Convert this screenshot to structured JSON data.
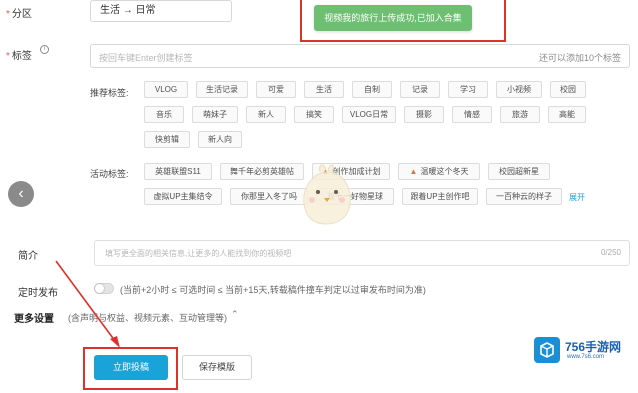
{
  "category": {
    "label": "分区",
    "value": "生活 → 日常"
  },
  "toast": {
    "text": "视频我的旅行上传成功,已加入合集"
  },
  "tags": {
    "label": "标签",
    "placeholder": "按回车键Enter创建标签",
    "hint": "还可以添加10个标签",
    "recommended_label": "推荐标签:",
    "recommended": [
      "VLOG",
      "生活记录",
      "可爱",
      "生活",
      "自制",
      "记录",
      "学习",
      "小视频",
      "校园",
      "音乐",
      "萌妹子",
      "新人",
      "搞笑",
      "VLOG日常",
      "摄影",
      "情感",
      "旅游",
      "高能",
      "快剪辑",
      "新人向"
    ],
    "activity_label": "活动标签:",
    "activity": [
      "英雄联盟S11",
      "舞千年必剪英雄帖",
      "创作加成计划",
      "温暖这个冬天",
      "校园超新星",
      "虚拟UP主集结令",
      "你那里入冬了吗",
      "双十一好物星球",
      "跟着UP主创作吧",
      "一百种云的样子"
    ],
    "expand": "展开"
  },
  "description": {
    "label": "简介",
    "placeholder": "填写更全面的相关信息,让更多的人能找到你的视频吧",
    "count": "0/250"
  },
  "schedule": {
    "label": "定时发布",
    "hint": "(当前+2小时 ≤ 可选时间 ≤ 当前+15天,转载稿件撞车判定以过审发布时间为准)"
  },
  "more_settings": {
    "label": "更多设置",
    "sub": "(含声明与权益、视频元素、互动管理等)"
  },
  "buttons": {
    "submit": "立即投稿",
    "save_template": "保存模版"
  },
  "watermark": {
    "title": "756手游网",
    "url": "www.7s6.com"
  },
  "colors": {
    "accent": "#1aa3d9",
    "toast": "#6fbf72",
    "highlight": "#e0302c"
  }
}
